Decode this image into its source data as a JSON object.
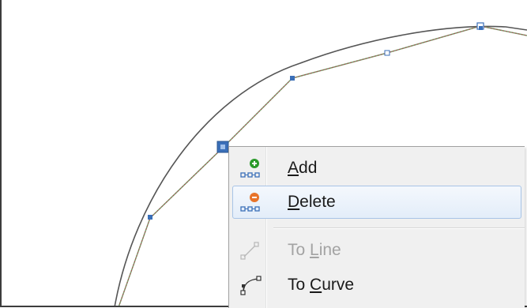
{
  "context_menu": {
    "items": [
      {
        "label": "Add",
        "icon": "add-node-icon",
        "enabled": true,
        "highlighted": false
      },
      {
        "label": "Delete",
        "icon": "delete-node-icon",
        "enabled": true,
        "highlighted": true
      },
      {
        "label": "To Line",
        "icon": "to-line-icon",
        "enabled": false,
        "highlighted": false
      },
      {
        "label": "To Curve",
        "icon": "to-curve-icon",
        "enabled": true,
        "highlighted": false
      }
    ]
  },
  "colors": {
    "curve": "#555555",
    "path": "#7a9c6a",
    "node_fill": "#3a6fb8",
    "selected_node": "#3a6fb8",
    "add_green": "#2a9a2a",
    "delete_orange": "#e8742a",
    "menu_bg": "#f0f0f0",
    "highlight_border": "#a8c4e6"
  }
}
